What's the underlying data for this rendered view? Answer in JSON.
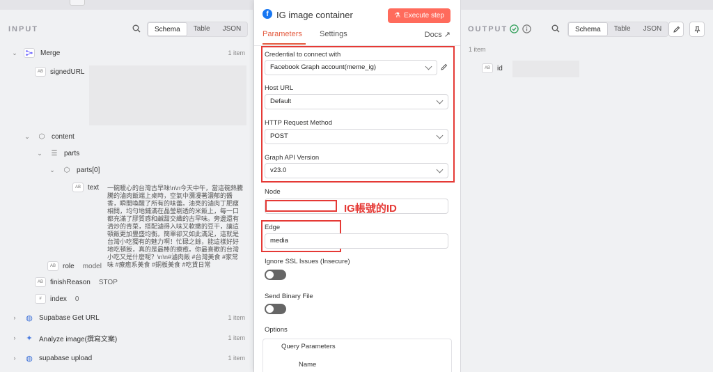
{
  "input": {
    "title": "INPUT",
    "view_tabs": [
      "Schema",
      "Table",
      "JSON"
    ],
    "nodes": [
      {
        "label": "Merge",
        "count": "1 item"
      },
      {
        "label": "Supabase Get URL",
        "count": "1 item"
      },
      {
        "label": "Analyze image(撰寫文案)",
        "count": "1 item"
      },
      {
        "label": "supabase upload",
        "count": "1 item"
      }
    ],
    "fields": {
      "signedURL": "signedURL",
      "content": "content",
      "parts": "parts",
      "parts0": "parts[0]",
      "text": "text",
      "text_value": "一碗暖心的台灣古早味\\n\\n今天中午，當這碗熱騰騰的滷肉飯端上桌時，空氣中瀰漫著濃郁的醬香，瞬間喚醒了所有的味蕾。油亮的滷肉丁肥瘦相間，均勻地鋪滿在晶瑩剔透的米飯上，每一口都充滿了膠質感和鹹甜交織的古早味。旁邊還有清炒的青菜，搭配滷得入味又軟嫩的豆干，讓這頓飯更加豐盛均衡。簡單卻又如此滿足，這就是台灣小吃獨有的魅力啊！忙碌之餘，能這樣好好地吃頓飯，真的是最棒的療癒。你最喜歡的台灣小吃又是什麼呢？\\n\\n#滷肉飯 #台灣美食 #家常味 #療癒系美食 #銅板美食 #吃貨日常",
      "role": "role",
      "role_value": "model",
      "finishReason": "finishReason",
      "finishReason_value": "STOP",
      "index": "index",
      "index_value": "0"
    }
  },
  "node": {
    "title": "IG image container",
    "execute_label": "Execute step",
    "tabs": {
      "parameters": "Parameters",
      "settings": "Settings",
      "docs": "Docs"
    },
    "credential_label": "Credential to connect with",
    "credential_value": "Facebook Graph account(meme_ig)",
    "host_url_label": "Host URL",
    "host_url_value": "Default",
    "method_label": "HTTP Request Method",
    "method_value": "POST",
    "version_label": "Graph API Version",
    "version_value": "v23.0",
    "node_label": "Node",
    "node_value": "",
    "annotation": "IG帳號的ID",
    "edge_label": "Edge",
    "edge_value": "media",
    "ssl_label": "Ignore SSL Issues (Insecure)",
    "binary_label": "Send Binary File",
    "options_label": "Options",
    "query_label": "Query Parameters",
    "name_label": "Name"
  },
  "output": {
    "title": "OUTPUT",
    "view_tabs": [
      "Schema",
      "Table",
      "JSON"
    ],
    "count": "1 item",
    "field": "id"
  },
  "colors": {
    "accent": "#e35a3e",
    "execute": "#ff6b5c",
    "annotation": "#e53935",
    "facebook": "#1877f2"
  }
}
